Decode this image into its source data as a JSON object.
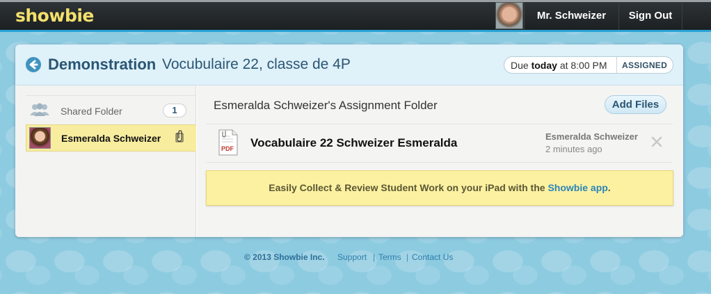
{
  "app": {
    "logo": "showbie"
  },
  "nav": {
    "user_name": "Mr. Schweizer",
    "sign_out": "Sign Out"
  },
  "header": {
    "title_bold": "Demonstration",
    "title_rest": "Vocubulaire 22, classe de 4P",
    "due_prefix": "Due",
    "due_day": "today",
    "due_time": "at 8:00 PM",
    "status": "ASSIGNED"
  },
  "sidebar": {
    "shared_folder_label": "Shared Folder",
    "shared_folder_count": "1",
    "student_name": "Esmeralda Schweizer"
  },
  "content": {
    "folder_title": "Esmeralda Schweizer's Assignment Folder",
    "add_files_label": "Add Files",
    "files": [
      {
        "name": "Vocabulaire 22 Schweizer Esmeralda",
        "author": "Esmeralda Schweizer",
        "time": "2 minutes ago",
        "type_label": "PDF"
      }
    ],
    "promo_text": "Easily Collect & Review Student Work on your iPad with the",
    "promo_link": "Showbie app",
    "promo_suffix": "."
  },
  "footer": {
    "copyright": "© 2013 Showbie Inc.",
    "links": [
      "Support",
      "Terms",
      "Contact Us"
    ]
  },
  "colors": {
    "accent": "#2aa3d6",
    "logo": "#f4e06b",
    "title": "#2a5573",
    "highlight": "#f8ed9f",
    "background": "#8dcbe1"
  },
  "icons": [
    "back-arrow-icon",
    "people-icon",
    "paperclip-icon",
    "pdf-file-icon",
    "close-icon"
  ]
}
